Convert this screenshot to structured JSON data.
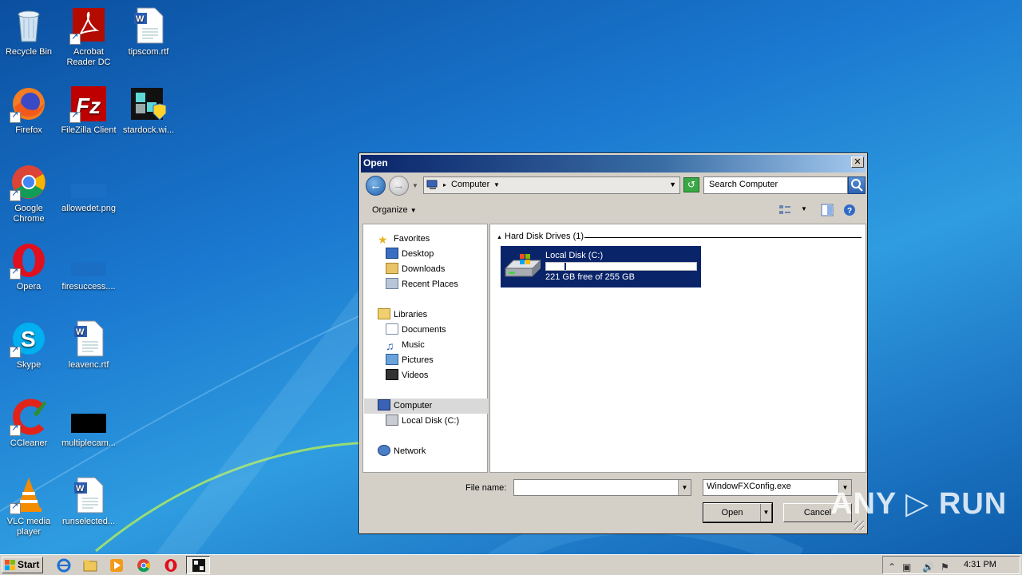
{
  "desktop": {
    "icons": [
      {
        "label": "Recycle Bin",
        "icon": "recycle-bin-icon"
      },
      {
        "label": "Acrobat Reader DC",
        "icon": "acrobat-icon"
      },
      {
        "label": "tipscom.rtf",
        "icon": "word-doc-icon"
      },
      {
        "label": "Firefox",
        "icon": "firefox-icon"
      },
      {
        "label": "FileZilla Client",
        "icon": "filezilla-icon"
      },
      {
        "label": "stardock.wi...",
        "icon": "stardock-installer-icon"
      },
      {
        "label": "Google Chrome",
        "icon": "chrome-icon"
      },
      {
        "label": "allowedet.png",
        "icon": "image-file-icon"
      },
      {
        "label": "Opera",
        "icon": "opera-icon"
      },
      {
        "label": "firesuccess....",
        "icon": "image-file-icon"
      },
      {
        "label": "Skype",
        "icon": "skype-icon"
      },
      {
        "label": "leavenc.rtf",
        "icon": "word-doc-icon"
      },
      {
        "label": "CCleaner",
        "icon": "ccleaner-icon"
      },
      {
        "label": "multiplecam...",
        "icon": "image-file-icon"
      },
      {
        "label": "VLC media player",
        "icon": "vlc-icon"
      },
      {
        "label": "runselected...",
        "icon": "word-doc-icon"
      }
    ]
  },
  "dialog": {
    "title": "Open",
    "close_label": "✕",
    "address_segments": [
      "Computer"
    ],
    "search_placeholder": "Search Computer",
    "organize_label": "Organize",
    "nav": {
      "favorites_label": "Favorites",
      "favorites": [
        "Desktop",
        "Downloads",
        "Recent Places"
      ],
      "libraries_label": "Libraries",
      "libraries": [
        "Documents",
        "Music",
        "Pictures",
        "Videos"
      ],
      "computer_label": "Computer",
      "computer_children": [
        "Local Disk (C:)"
      ],
      "network_label": "Network"
    },
    "group_header": "Hard Disk Drives (1)",
    "drive": {
      "name": "Local Disk (C:)",
      "free_text": "221 GB free of 255 GB",
      "used_fraction": 0.133
    },
    "file_name_label": "File name:",
    "file_name_value": "",
    "file_type_value": "WindowFXConfig.exe",
    "open_label": "Open",
    "cancel_label": "Cancel"
  },
  "taskbar": {
    "start_label": "Start",
    "clock": "4:31 PM"
  },
  "watermark": "ANY ▷ RUN"
}
